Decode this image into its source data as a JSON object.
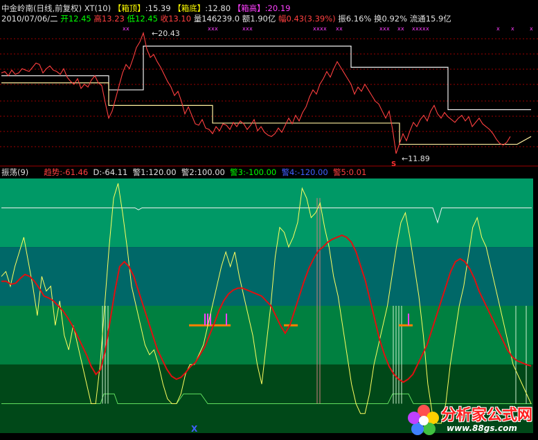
{
  "header": {
    "stock_name": "中金岭南(日线,前复权)",
    "indicator_name": "XT(10)",
    "box_top_label": "【箱顶】",
    "box_top_value": ":15.39",
    "box_bottom_label": "【箱底】",
    "box_bottom_value": ":12.80",
    "box_height_label": "【箱高】",
    "box_height_value": ":20.19"
  },
  "quote": {
    "date": "2010/07/06/二",
    "open_label": "开",
    "open": "12.45",
    "high_label": "高",
    "high": "13.23",
    "low_label": "低",
    "low": "12.45",
    "close_label": "收",
    "close": "13.10",
    "volume_label": "量",
    "volume": "146239.0",
    "amount_label": "额",
    "amount": "1.90亿",
    "change_label": "幅",
    "change": "0.43(3.39%)",
    "amplitude_label": "振",
    "amplitude": "6.16%",
    "turnover_label": "换",
    "turnover": "0.92%",
    "float_label": "流通",
    "float": "15.9亿"
  },
  "annotations": {
    "high_mark": "20.43",
    "low_mark": "11.89",
    "sell_marker": "xx",
    "low_glyph": "S"
  },
  "lower_header": {
    "name": "振荡(9)",
    "trend_label": "趋势",
    "trend_value": ":-61.46",
    "d_label": "D",
    "d_value": ":-64.11",
    "w1_label": "警1",
    "w1_value": ":120.00",
    "w2_label": "警2",
    "w2_value": ":100.00",
    "w3_label": "警3",
    "w3_value": ":-100.00",
    "w4_label": "警4",
    "w4_value": ":-120.00",
    "w5_label": "警5",
    "w5_value": ":0.01"
  },
  "watermark": {
    "cn": "分析家公式网",
    "url": "www.88gs.com"
  },
  "colors": {
    "background": "#000000",
    "price_line": "#ff4040",
    "box_line": "#ffffff",
    "osc_yellow": "#ffff60",
    "osc_red": "#e01010",
    "band_top": "#009966",
    "band_mid": "#006868",
    "band_low": "#008040",
    "band_bottom": "#004818",
    "grid_dash": "#a00000"
  },
  "chart_data": [
    {
      "type": "line",
      "name": "price panel",
      "x": [
        0,
        5,
        10,
        15,
        20,
        25,
        30,
        35,
        40,
        45,
        50,
        55,
        60,
        65,
        70,
        75,
        80,
        85,
        90,
        95,
        100,
        105,
        110,
        115,
        120,
        125,
        130,
        135,
        140,
        145,
        150,
        155,
        160,
        165,
        170,
        175,
        180,
        185,
        190,
        195,
        200,
        205,
        210,
        215,
        220,
        225,
        230,
        235,
        240,
        245,
        250,
        255,
        260,
        265,
        270,
        275,
        280,
        285,
        290,
        295,
        300,
        305,
        310,
        315,
        320,
        325,
        330,
        335,
        340,
        345,
        350,
        355,
        360,
        365,
        370,
        375,
        380,
        385,
        390,
        395,
        400,
        405,
        410,
        415,
        420,
        425,
        430,
        435,
        440,
        445,
        450,
        455,
        460,
        465,
        470,
        475,
        480,
        485,
        490,
        495,
        500,
        505,
        510,
        515,
        520,
        525,
        530,
        535,
        540,
        545,
        550,
        555,
        560,
        565,
        570,
        575,
        580,
        585,
        590,
        595,
        600,
        605,
        610,
        615,
        620,
        625,
        630,
        635,
        640,
        645,
        650,
        655,
        660,
        665,
        670,
        675,
        680,
        685,
        690,
        695,
        700,
        705,
        710,
        715,
        720,
        725,
        730,
        735,
        740,
        745,
        750,
        755,
        760,
        765
      ],
      "series": [
        {
          "values": [
            17.6,
            17.7,
            17.4,
            17.8,
            17.5,
            17.6,
            17.9,
            17.8,
            17.7,
            18.0,
            18.3,
            18.2,
            17.6,
            17.9,
            18.1,
            17.8,
            17.7,
            17.5,
            17.9,
            17.3,
            17.0,
            16.8,
            17.2,
            16.5,
            16.8,
            16.6,
            17.1,
            17.4,
            16.9,
            16.7,
            15.5,
            14.4,
            14.9,
            15.8,
            16.7,
            17.6,
            18.2,
            17.9,
            18.6,
            19.4,
            19.8,
            20.43,
            19.3,
            18.7,
            18.9,
            18.4,
            18.0,
            17.5,
            17.0,
            16.6,
            16.0,
            16.3,
            15.6,
            14.7,
            15.2,
            14.6,
            14.0,
            13.9,
            14.3,
            13.7,
            13.6,
            13.3,
            13.8,
            13.5,
            14.0,
            13.9,
            13.6,
            14.1,
            13.8,
            14.2,
            14.0,
            13.6,
            13.9,
            14.3,
            13.5,
            13.8,
            13.4,
            13.2,
            13.1,
            13.3,
            13.7,
            13.4,
            13.9,
            14.4,
            14.0,
            14.6,
            14.2,
            14.8,
            15.2,
            15.9,
            16.4,
            16.1,
            16.8,
            17.2,
            17.7,
            17.3,
            17.9,
            18.4,
            18.0,
            17.6,
            17.2,
            16.8,
            16.1,
            16.6,
            16.3,
            16.8,
            16.4,
            16.0,
            15.6,
            15.4,
            14.9,
            14.4,
            14.9,
            13.6,
            11.89,
            12.6,
            13.3,
            12.8,
            13.5,
            14.1,
            13.8,
            14.3,
            14.6,
            14.2,
            14.9,
            15.3,
            14.7,
            14.4,
            14.8,
            14.5,
            14.3,
            14.1,
            14.4,
            14.6,
            14.2,
            14.5,
            13.8,
            14.1,
            14.4,
            14.0,
            13.8,
            13.6,
            13.3,
            12.9,
            12.6,
            12.5,
            12.7,
            13.1
          ]
        }
      ],
      "box_levels": [
        17.4,
        15.39,
        14.05,
        12.8
      ],
      "ylim": [
        11.5,
        21.0
      ]
    },
    {
      "type": "line",
      "name": "振荡(9)",
      "x": [
        0,
        5,
        10,
        15,
        20,
        25,
        30,
        35,
        40,
        45,
        50,
        55,
        60,
        65,
        70,
        75,
        80,
        85,
        90,
        95,
        100,
        105,
        110,
        115,
        120,
        125,
        130,
        135,
        140,
        145,
        150,
        155,
        160,
        165,
        170,
        175,
        180,
        185,
        190,
        195,
        200,
        205,
        210,
        215,
        220,
        225,
        230,
        235,
        240,
        245,
        250,
        255,
        260,
        265,
        270,
        275,
        280,
        285,
        290,
        295,
        300,
        305,
        310,
        315,
        320,
        325,
        330,
        335,
        340,
        345,
        350,
        355,
        360,
        365,
        370,
        375,
        380,
        385,
        390,
        395,
        400,
        405,
        410,
        415,
        420,
        425,
        430,
        435,
        440,
        445,
        450,
        455,
        460,
        465,
        470,
        475,
        480,
        485,
        490,
        495,
        500,
        505,
        510,
        515,
        520,
        525,
        530,
        535,
        540,
        545,
        550,
        555,
        560,
        565,
        570,
        575,
        580,
        585,
        590,
        595,
        600,
        605,
        610,
        615,
        620,
        625,
        630,
        635,
        640,
        645,
        650,
        655,
        660,
        665,
        670,
        675,
        680,
        685,
        690,
        695,
        700,
        705,
        710,
        715,
        720,
        725,
        730,
        735,
        740,
        745,
        750,
        755,
        760,
        765
      ],
      "series": [
        {
          "name": "D",
          "values": [
            30,
            35,
            20,
            40,
            55,
            70,
            45,
            20,
            -10,
            30,
            15,
            20,
            -20,
            5,
            -30,
            -45,
            -20,
            -40,
            -60,
            -80,
            -100,
            -100,
            -60,
            0,
            60,
            110,
            125,
            95,
            60,
            20,
            0,
            -20,
            -40,
            -50,
            -45,
            -60,
            -80,
            -95,
            -100,
            -100,
            -90,
            -70,
            -60,
            -60,
            -50,
            -40,
            -20,
            0,
            20,
            40,
            55,
            40,
            55,
            30,
            10,
            -10,
            -30,
            -60,
            -80,
            -40,
            0,
            50,
            80,
            75,
            60,
            70,
            85,
            120,
            110,
            90,
            95,
            105,
            80,
            60,
            30,
            10,
            -20,
            -50,
            -80,
            -100,
            -110,
            -110,
            -90,
            -60,
            -40,
            -20,
            0,
            30,
            60,
            85,
            95,
            70,
            40,
            10,
            -30,
            -80,
            -110,
            -120,
            -120,
            -100,
            -60,
            -30,
            0,
            20,
            50,
            80,
            90,
            70,
            60,
            40,
            20,
            0,
            -20,
            -40,
            -60,
            -70,
            -80,
            -90,
            -100
          ],
          "color": "yellow"
        },
        {
          "name": "趋势",
          "values": [
            25,
            25,
            22,
            23,
            28,
            32,
            30,
            25,
            18,
            10,
            8,
            5,
            0,
            -5,
            -12,
            -20,
            -30,
            -40,
            -50,
            -62,
            -70,
            -65,
            -45,
            -15,
            15,
            40,
            45,
            40,
            30,
            15,
            0,
            -15,
            -30,
            -45,
            -55,
            -65,
            -72,
            -75,
            -73,
            -68,
            -62,
            -58,
            -50,
            -42,
            -30,
            -18,
            -5,
            5,
            12,
            16,
            18,
            18,
            16,
            14,
            12,
            10,
            5,
            0,
            -10,
            -20,
            -28,
            -20,
            -5,
            10,
            25,
            38,
            48,
            56,
            60,
            65,
            68,
            70,
            72,
            70,
            65,
            55,
            40,
            25,
            5,
            -15,
            -35,
            -50,
            -62,
            -70,
            -75,
            -78,
            -75,
            -70,
            -60,
            -50,
            -40,
            -25,
            -10,
            5,
            20,
            35,
            45,
            48,
            45,
            38,
            28,
            15,
            5,
            -5,
            -15,
            -25,
            -35,
            -45,
            -52,
            -56,
            -58,
            -60,
            -61.46
          ],
          "color": "red"
        }
      ],
      "reference_levels": [
        120,
        100,
        0,
        -100,
        -120
      ],
      "ylim": [
        -130,
        130
      ]
    }
  ]
}
